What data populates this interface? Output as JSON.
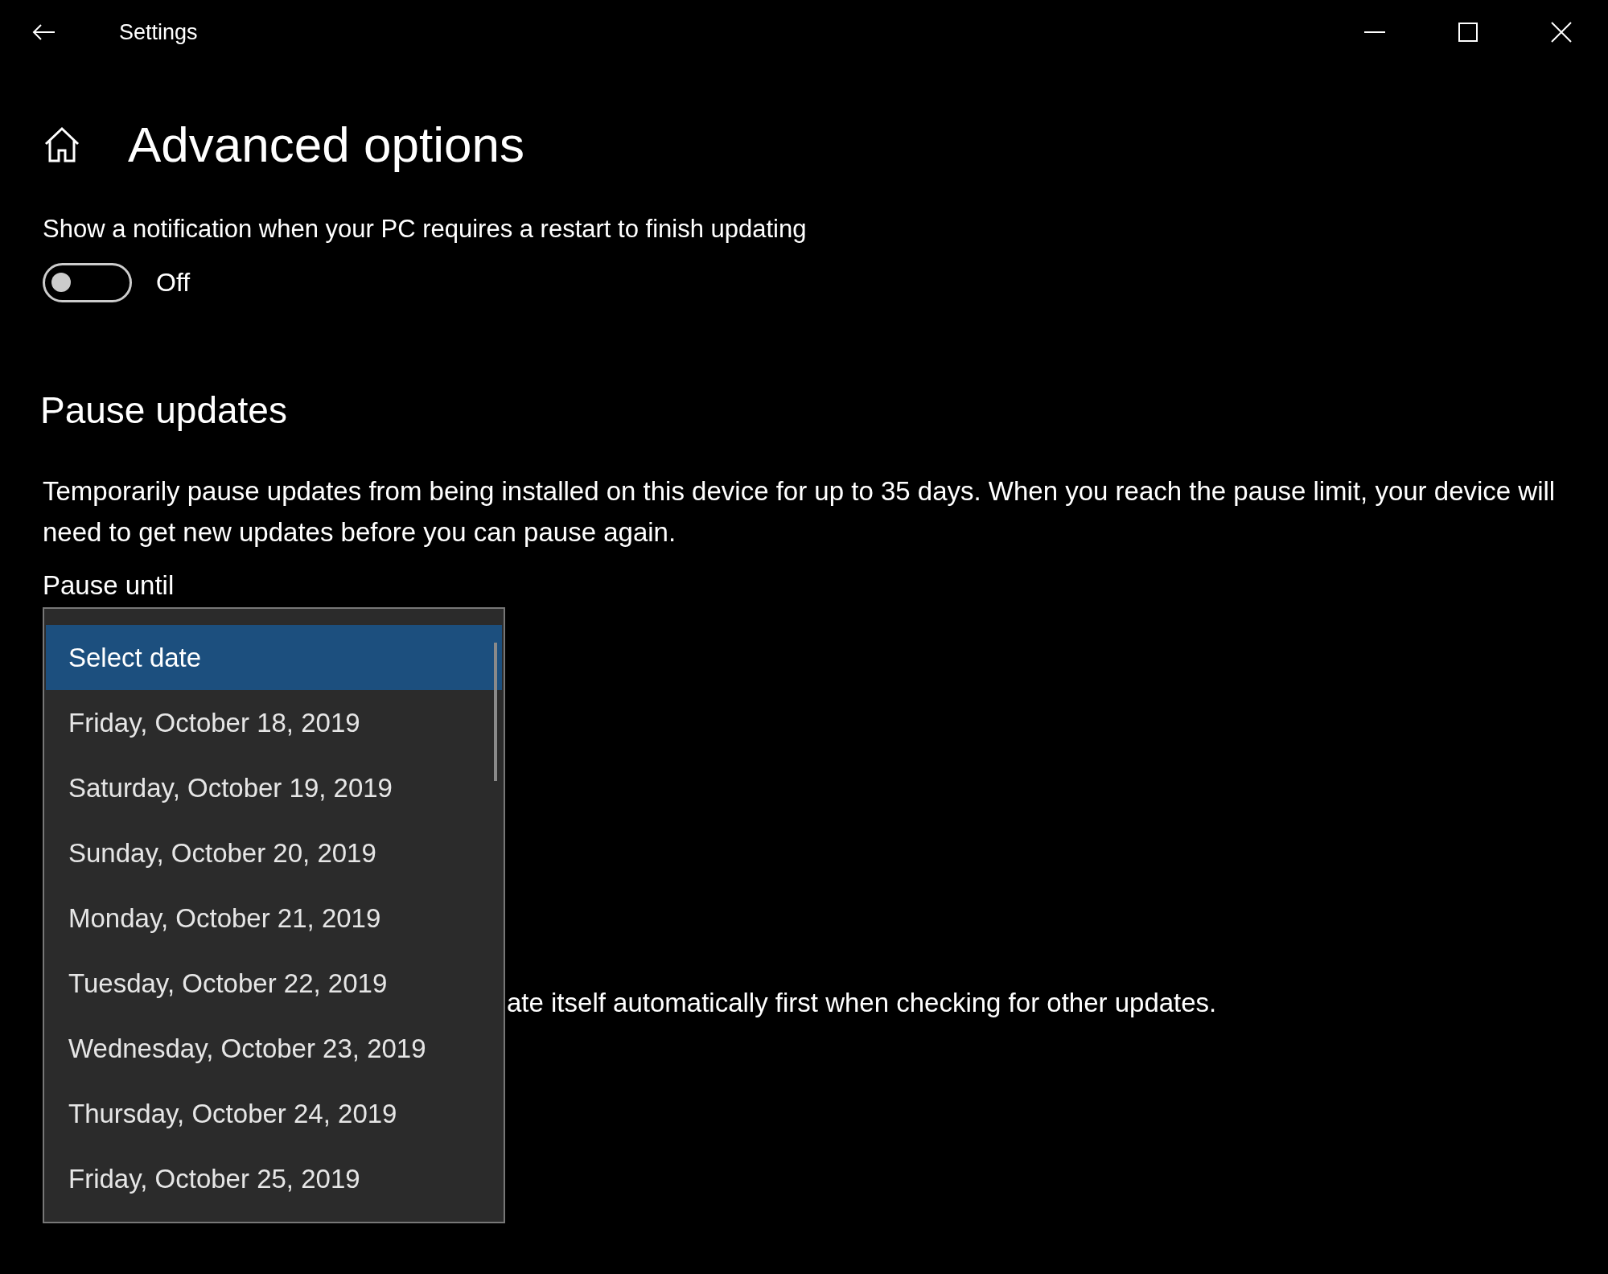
{
  "window": {
    "title": "Settings"
  },
  "page_title": "Advanced options",
  "notification_setting": {
    "label": "Show a notification when your PC requires a restart to finish updating",
    "on": false,
    "state_text": "Off"
  },
  "pause_updates": {
    "heading": "Pause updates",
    "description": "Temporarily pause updates from being installed on this device for up to 35 days. When you reach the pause limit, your device will need to get new updates before you can pause again.",
    "field_label": "Pause until",
    "options": [
      {
        "label": "Select date",
        "selected": true
      },
      {
        "label": "Friday, October 18, 2019",
        "selected": false
      },
      {
        "label": "Saturday, October 19, 2019",
        "selected": false
      },
      {
        "label": "Sunday, October 20, 2019",
        "selected": false
      },
      {
        "label": "Monday, October 21, 2019",
        "selected": false
      },
      {
        "label": "Tuesday, October 22, 2019",
        "selected": false
      },
      {
        "label": "Wednesday, October 23, 2019",
        "selected": false
      },
      {
        "label": "Thursday, October 24, 2019",
        "selected": false
      },
      {
        "label": "Friday, October 25, 2019",
        "selected": false
      }
    ]
  },
  "covered_text": "ate itself automatically first when checking for other updates."
}
